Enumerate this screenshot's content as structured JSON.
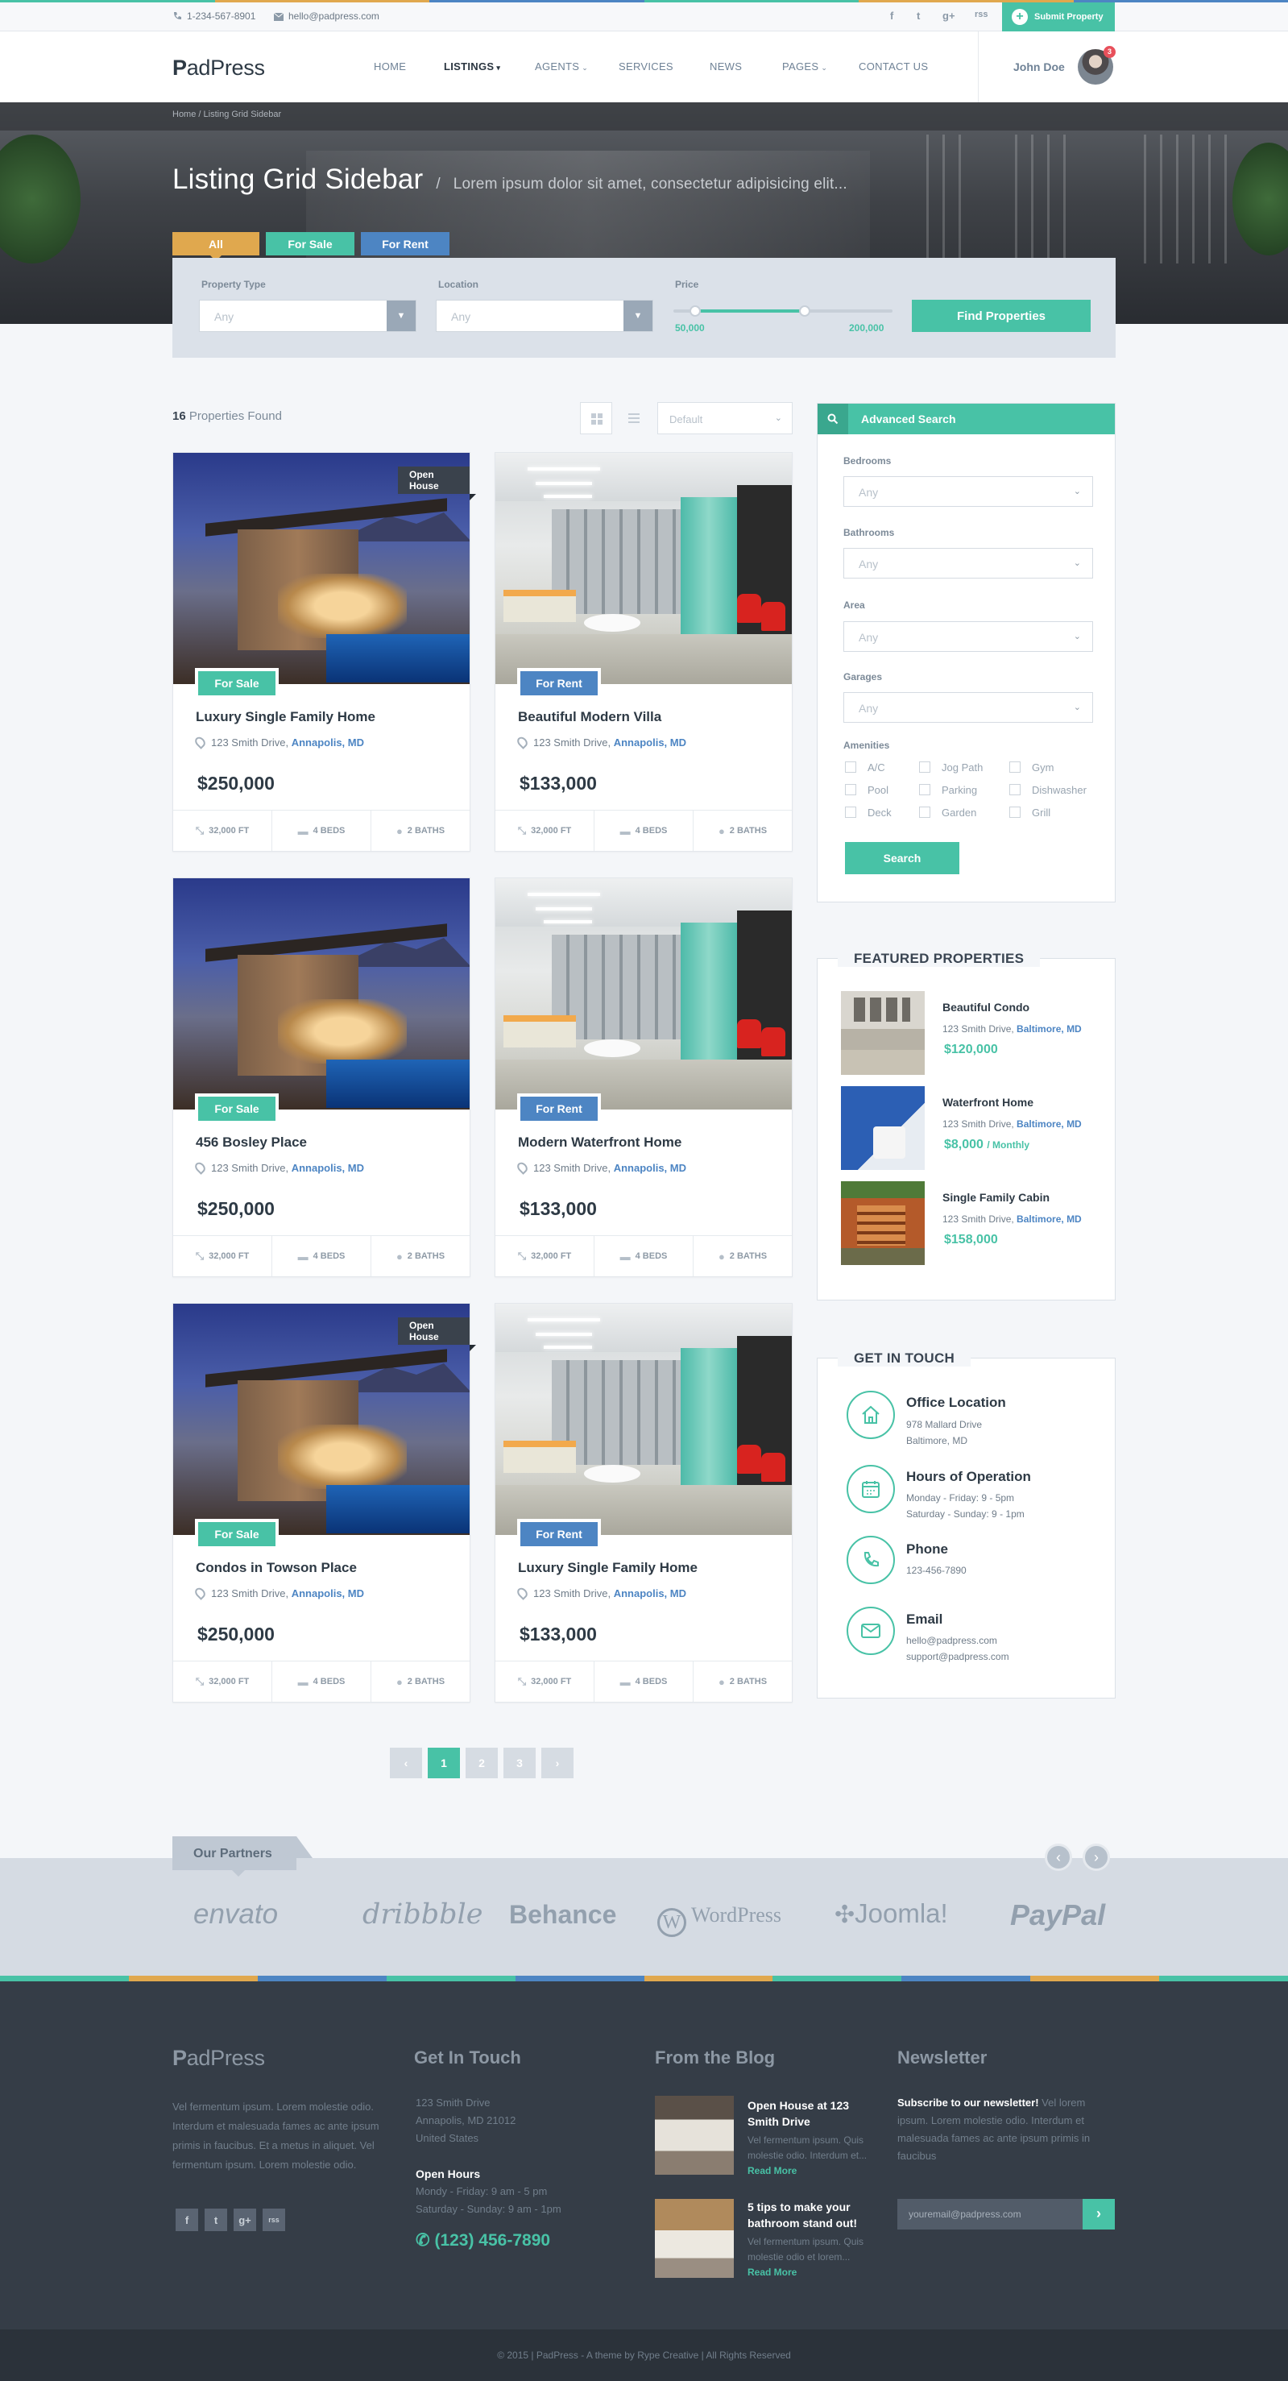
{
  "topbar": {
    "phone": "1-234-567-8901",
    "email": "hello@padpress.com",
    "social": [
      "f",
      "t",
      "g+",
      "rss"
    ],
    "submit_label": "Submit Property"
  },
  "brand": {
    "name_bold": "P",
    "name_rest": "adPress",
    "accent": "#48c2a6",
    "gold": "#e0a84e",
    "blue": "#4d85c3",
    "dark": "#353d47"
  },
  "nav": {
    "items": [
      "HOME",
      "LISTINGS",
      "AGENTS",
      "SERVICES",
      "NEWS",
      "PAGES",
      "CONTACT US"
    ],
    "user_name": "John Doe",
    "notif_count": "3"
  },
  "hero": {
    "breadcrumb": "Home / Listing Grid Sidebar",
    "title": "Listing Grid Sidebar",
    "separator": "/",
    "subtitle": "Lorem ipsum dolor sit amet, consectetur adipisicing elit...",
    "tabs": [
      "All",
      "For Sale",
      "For Rent"
    ]
  },
  "filter": {
    "property_type_label": "Property Type",
    "property_type_value": "Any",
    "location_label": "Location",
    "location_value": "Any",
    "price_label": "Price",
    "price_min": "50,000",
    "price_max": "200,000",
    "range_fraction": [
      0.1,
      0.6
    ],
    "button": "Find Properties"
  },
  "results": {
    "count": "16",
    "count_label": "Properties Found",
    "sort_value": "Default"
  },
  "listings": [
    {
      "title": "Luxury Single Family Home",
      "address": "123 Smith Drive,",
      "city": "Annapolis, MD",
      "price": "$250,000",
      "status": "For Sale",
      "ribbon": "Open House",
      "sqft": "32,000 FT",
      "beds": "4 BEDS",
      "baths": "2 BATHS"
    },
    {
      "title": "Beautiful Modern Villa",
      "address": "123 Smith Drive,",
      "city": "Annapolis, MD",
      "price": "$133,000",
      "status": "For Rent",
      "ribbon": "",
      "sqft": "32,000 FT",
      "beds": "4 BEDS",
      "baths": "2 BATHS"
    },
    {
      "title": "456 Bosley Place",
      "address": "123 Smith Drive,",
      "city": "Annapolis, MD",
      "price": "$250,000",
      "status": "For Sale",
      "ribbon": "",
      "sqft": "32,000 FT",
      "beds": "4 BEDS",
      "baths": "2 BATHS"
    },
    {
      "title": "Modern Waterfront Home",
      "address": "123 Smith Drive,",
      "city": "Annapolis, MD",
      "price": "$133,000",
      "status": "For Rent",
      "ribbon": "",
      "sqft": "32,000 FT",
      "beds": "4 BEDS",
      "baths": "2 BATHS"
    },
    {
      "title": "Condos in Towson Place",
      "address": "123 Smith Drive,",
      "city": "Annapolis, MD",
      "price": "$250,000",
      "status": "For Sale",
      "ribbon": "Open House",
      "sqft": "32,000 FT",
      "beds": "4 BEDS",
      "baths": "2 BATHS"
    },
    {
      "title": "Luxury Single Family Home",
      "address": "123 Smith Drive,",
      "city": "Annapolis, MD",
      "price": "$133,000",
      "status": "For Rent",
      "ribbon": "",
      "sqft": "32,000 FT",
      "beds": "4 BEDS",
      "baths": "2 BATHS"
    }
  ],
  "pagination": {
    "prev": "‹",
    "pages": [
      "1",
      "2",
      "3"
    ],
    "next": "›",
    "current": "1"
  },
  "advanced_search": {
    "title": "Advanced Search",
    "fields": [
      {
        "label": "Bedrooms",
        "value": "Any"
      },
      {
        "label": "Bathrooms",
        "value": "Any"
      },
      {
        "label": "Area",
        "value": "Any"
      },
      {
        "label": "Garages",
        "value": "Any"
      }
    ],
    "amenities_label": "Amenities",
    "amenities": [
      "A/C",
      "Jog Path",
      "Gym",
      "Pool",
      "Parking",
      "Dishwasher",
      "Deck",
      "Garden",
      "Grill"
    ],
    "button": "Search"
  },
  "featured": {
    "title": "FEATURED PROPERTIES",
    "items": [
      {
        "title": "Beautiful Condo",
        "address": "123 Smith Drive,",
        "city": "Baltimore, MD",
        "price": "$120,000",
        "period": ""
      },
      {
        "title": "Waterfront Home",
        "address": "123 Smith Drive,",
        "city": "Baltimore, MD",
        "price": "$8,000",
        "period": "/ Monthly"
      },
      {
        "title": "Single Family Cabin",
        "address": "123 Smith Drive,",
        "city": "Baltimore, MD",
        "price": "$158,000",
        "period": ""
      }
    ]
  },
  "contact": {
    "title": "GET IN TOUCH",
    "office_title": "Office Location",
    "office_l1": "978 Mallard Drive",
    "office_l2": "Baltimore, MD",
    "hours_title": "Hours of Operation",
    "hours_l1": "Monday - Friday: 9 - 5pm",
    "hours_l2": "Saturday - Sunday: 9 - 1pm",
    "phone_title": "Phone",
    "phone_l1": "123-456-7890",
    "email_title": "Email",
    "email_l1": "hello@padpress.com",
    "email_l2": "support@padpress.com"
  },
  "partners": {
    "label": "Our Partners",
    "logos": [
      "envato",
      "dribbble",
      "Behance",
      "WordPress",
      "Joomla!",
      "PayPal"
    ]
  },
  "footer": {
    "about": "Vel fermentum ipsum. Lorem molestie odio. Interdum et malesuada fames ac ante ipsum primis in faucibus. Et a metus in aliquet. Vel fermentum ipsum. Lorem molestie odio.",
    "touch_title": "Get In Touch",
    "addr_l1": "123 Smith Drive",
    "addr_l2": "Annapolis, MD 21012",
    "addr_l3": "United States",
    "hours_title": "Open Hours",
    "hours_l1": "Mondy - Friday: 9 am - 5 pm",
    "hours_l2": "Saturday - Sunday: 9 am - 1pm",
    "phone": "(123) 456-7890",
    "blog_title": "From the Blog",
    "posts": [
      {
        "title": "Open House at 123 Smith Drive",
        "excerpt": "Vel fermentum ipsum. Quis molestie odio. Interdum et...",
        "more": "Read More"
      },
      {
        "title": "5 tips to make your bathroom stand out!",
        "excerpt": "Vel fermentum ipsum. Quis molestie odio et lorem...",
        "more": "Read More"
      }
    ],
    "newsletter_title": "Newsletter",
    "newsletter_lead": "Subscribe to our newsletter!",
    "newsletter_text": "Vel lorem ipsum. Lorem molestie odio. Interdum et malesuada fames ac ante ipsum primis in faucibus",
    "newsletter_placeholder": "youremail@padpress.com",
    "copyright": "© 2015  |  PadPress - A theme by Rype Creative  |  All Rights Reserved"
  }
}
